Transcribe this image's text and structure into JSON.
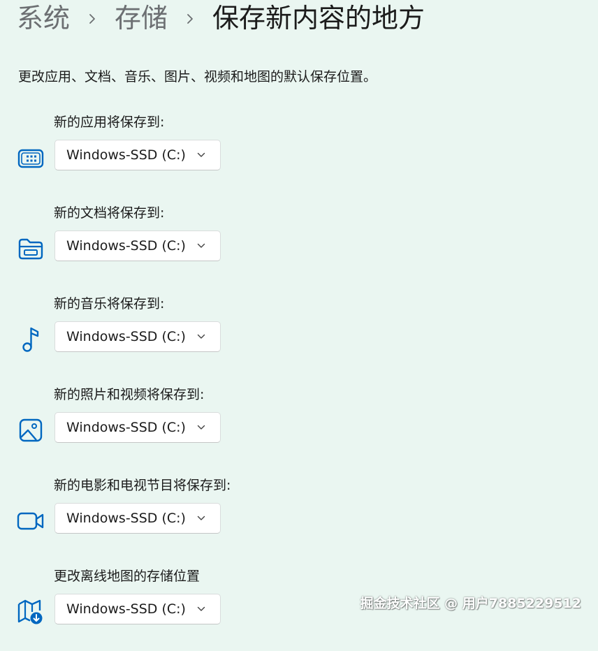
{
  "breadcrumb": {
    "items": [
      "系统",
      "存储"
    ],
    "current": "保存新内容的地方"
  },
  "description": "更改应用、文档、音乐、图片、视频和地图的默认保存位置。",
  "settings": [
    {
      "label": "新的应用将保存到:",
      "value": "Windows-SSD (C:)",
      "icon": "apps-icon"
    },
    {
      "label": "新的文档将保存到:",
      "value": "Windows-SSD (C:)",
      "icon": "folder-icon"
    },
    {
      "label": "新的音乐将保存到:",
      "value": "Windows-SSD (C:)",
      "icon": "music-note-icon"
    },
    {
      "label": "新的照片和视频将保存到:",
      "value": "Windows-SSD (C:)",
      "icon": "photo-icon"
    },
    {
      "label": "新的电影和电视节目将保存到:",
      "value": "Windows-SSD (C:)",
      "icon": "video-camera-icon"
    },
    {
      "label": "更改离线地图的存储位置",
      "value": "Windows-SSD (C:)",
      "icon": "offline-map-icon"
    }
  ],
  "watermark": "掘金技术社区 @ 用户7885229512",
  "colors": {
    "background": "#eaf6f1",
    "accent": "#0067c0",
    "text": "#1b1b1b",
    "secondary_text": "#6c6f72"
  }
}
